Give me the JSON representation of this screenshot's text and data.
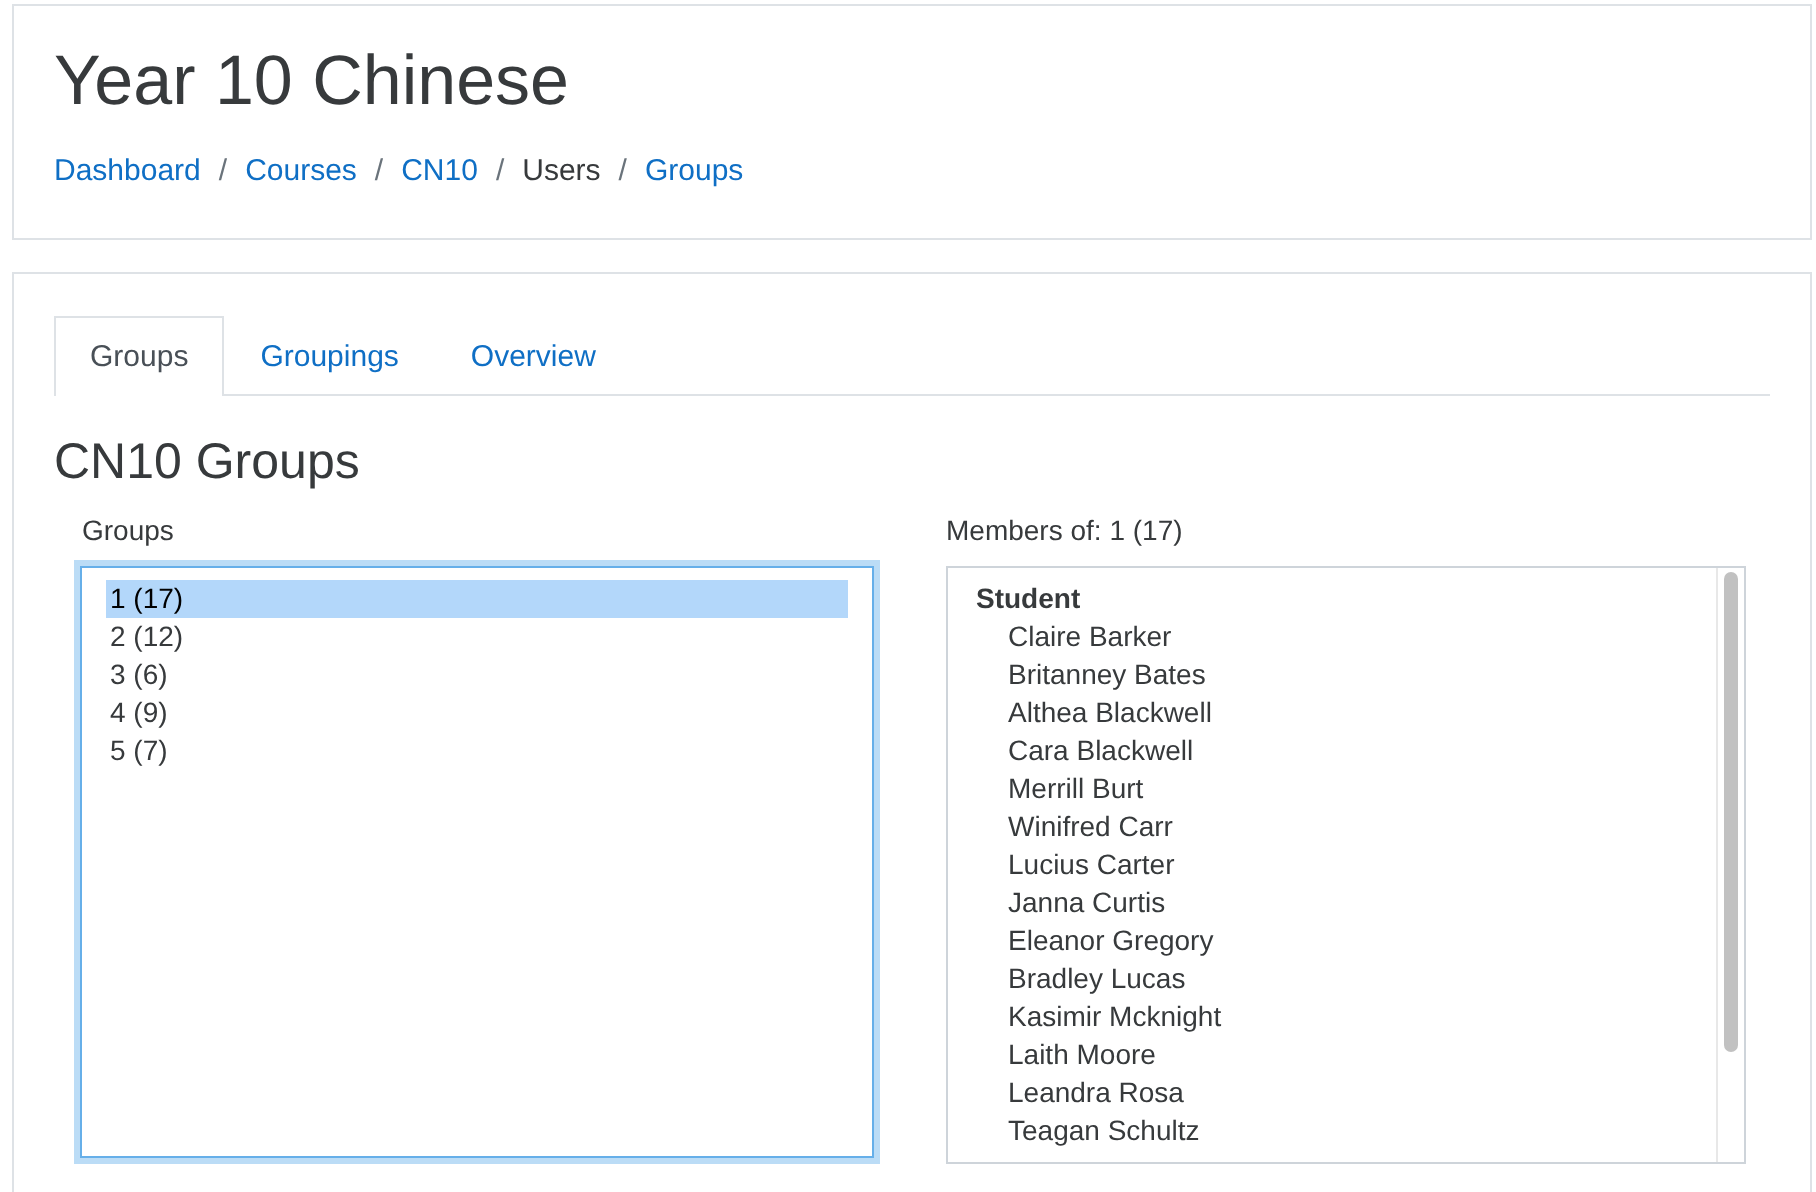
{
  "page_title": "Year 10 Chinese",
  "breadcrumb": [
    {
      "label": "Dashboard",
      "link": true
    },
    {
      "separator": "/",
      "label": "Courses",
      "link": true
    },
    {
      "separator": "/",
      "label": "CN10",
      "link": true
    },
    {
      "separator": "/",
      "label": "Users",
      "link": false
    },
    {
      "separator": "/",
      "label": "Groups",
      "link": true
    }
  ],
  "tabs": [
    {
      "label": "Groups",
      "selected": true
    },
    {
      "label": "Groupings",
      "selected": false
    },
    {
      "label": "Overview",
      "selected": false
    }
  ],
  "heading": "CN10 Groups",
  "groups": {
    "label": "Groups",
    "items": [
      {
        "label": "1 (17)",
        "selected": true
      },
      {
        "label": "2 (12)",
        "selected": false
      },
      {
        "label": "3 (6)",
        "selected": false
      },
      {
        "label": "4 (9)",
        "selected": false
      },
      {
        "label": "5 (7)",
        "selected": false
      }
    ]
  },
  "members": {
    "label": "Members of: 1 (17)",
    "role": "Student",
    "names": [
      "Claire Barker",
      "Britanney Bates",
      "Althea Blackwell",
      "Cara Blackwell",
      "Merrill Burt",
      "Winifred Carr",
      "Lucius Carter",
      "Janna Curtis",
      "Eleanor Gregory",
      "Bradley Lucas",
      "Kasimir Mcknight",
      "Laith Moore",
      "Leandra Rosa",
      "Teagan Schultz"
    ]
  }
}
